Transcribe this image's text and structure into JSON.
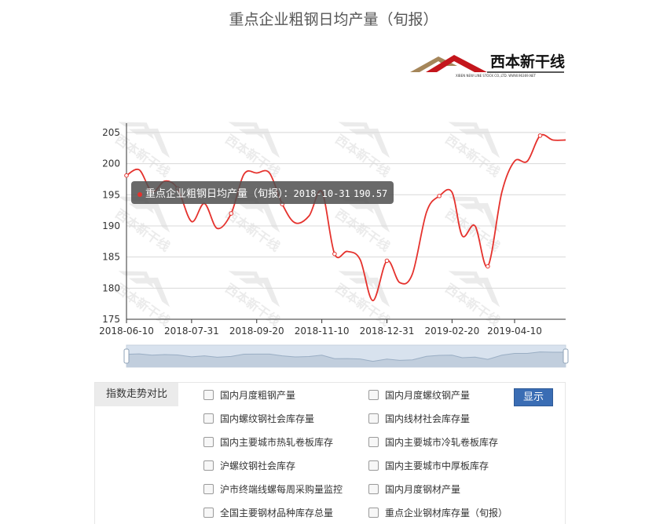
{
  "chart_data": {
    "type": "line",
    "title": "重点企业粗钢日均产量（旬报）",
    "x_tick_labels": [
      "2018-06-10",
      "2018-07-31",
      "2018-09-20",
      "2018-11-10",
      "2018-12-31",
      "2019-02-20",
      "2019-04-10"
    ],
    "y_ticks": [
      175,
      180,
      185,
      190,
      195,
      200,
      205
    ],
    "ylim": [
      175,
      206
    ],
    "grid": true,
    "series": [
      {
        "name": "重点企业粗钢日均产量（旬报）",
        "color": "#e5322d",
        "x": [
          "2018-06-10",
          "2018-06-20",
          "2018-06-30",
          "2018-07-10",
          "2018-07-20",
          "2018-07-31",
          "2018-08-10",
          "2018-08-20",
          "2018-08-31",
          "2018-09-10",
          "2018-09-20",
          "2018-09-30",
          "2018-10-10",
          "2018-10-20",
          "2018-10-31",
          "2018-11-10",
          "2018-11-20",
          "2018-11-30",
          "2018-12-10",
          "2018-12-20",
          "2018-12-31",
          "2019-01-10",
          "2019-01-20",
          "2019-01-31",
          "2019-02-10",
          "2019-02-20",
          "2019-02-28",
          "2019-03-10",
          "2019-03-20",
          "2019-03-31",
          "2019-04-10",
          "2019-04-20",
          "2019-04-30",
          "2019-05-10",
          "2019-05-20"
        ],
        "values": [
          198.1,
          199.0,
          195.5,
          197.2,
          196.0,
          190.7,
          193.6,
          189.6,
          192.0,
          198.3,
          198.5,
          198.5,
          193.5,
          190.5,
          191.6,
          195.5,
          185.5,
          185.9,
          184.6,
          178.0,
          184.4,
          180.9,
          182.3,
          192.2,
          194.8,
          195.4,
          188.4,
          190.0,
          183.5,
          195.4,
          200.4,
          200.4,
          204.5,
          203.8,
          203.8
        ]
      }
    ]
  },
  "tooltip": {
    "series_name": "重点企业粗钢日均产量（旬报）",
    "separator": "：",
    "date": "2018-10-31",
    "value": "190.57"
  },
  "logo": {
    "text": "西本新干线",
    "subtext": "XIBEN NEW LINE STOCK CO.,LTD.   WWW.96369.NET"
  },
  "compare_panel": {
    "label": "指数走势对比",
    "show_button": "显示",
    "options": [
      "国内月度粗钢产量",
      "国内月度螺纹钢产量",
      "国内螺纹钢社会库存量",
      "国内线材社会库存量",
      "国内主要城市热轧卷板库存",
      "国内主要城市冷轧卷板库存",
      "沪螺纹钢社会库存",
      "国内主要城市中厚板库存",
      "沪市终端线螺每周采购量监控",
      "国内月度钢材产量",
      "全国主要钢材品种库存总量",
      "重点企业钢材库存量（旬报）"
    ]
  }
}
